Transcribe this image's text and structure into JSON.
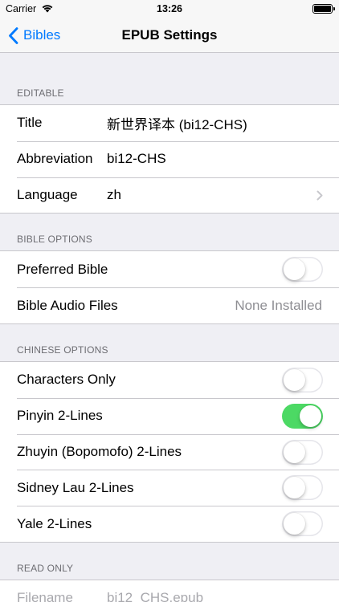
{
  "status_bar": {
    "carrier": "Carrier",
    "time": "13:26"
  },
  "nav": {
    "back_label": "Bibles",
    "title": "EPUB Settings"
  },
  "sections": {
    "editable": {
      "header": "EDITABLE",
      "title_label": "Title",
      "title_value": "新世界译本 (bi12-CHS)",
      "abbrev_label": "Abbreviation",
      "abbrev_value": "bi12-CHS",
      "language_label": "Language",
      "language_value": "zh"
    },
    "bible_options": {
      "header": "BIBLE OPTIONS",
      "preferred_label": "Preferred Bible",
      "preferred_on": false,
      "audio_label": "Bible Audio Files",
      "audio_value": "None Installed"
    },
    "chinese_options": {
      "header": "CHINESE OPTIONS",
      "toggles": [
        {
          "label": "Characters Only",
          "on": false
        },
        {
          "label": "Pinyin 2-Lines",
          "on": true
        },
        {
          "label": "Zhuyin (Bopomofo) 2-Lines",
          "on": false
        },
        {
          "label": "Sidney Lau 2-Lines",
          "on": false
        },
        {
          "label": "Yale 2-Lines",
          "on": false
        }
      ]
    },
    "read_only": {
      "header": "READ ONLY",
      "filename_label": "Filename",
      "filename_value": "bi12_CHS.epub"
    }
  },
  "colors": {
    "accent": "#007aff",
    "toggle_on": "#4cd964",
    "background": "#efeff4",
    "secondary_text": "#8e8e93"
  }
}
